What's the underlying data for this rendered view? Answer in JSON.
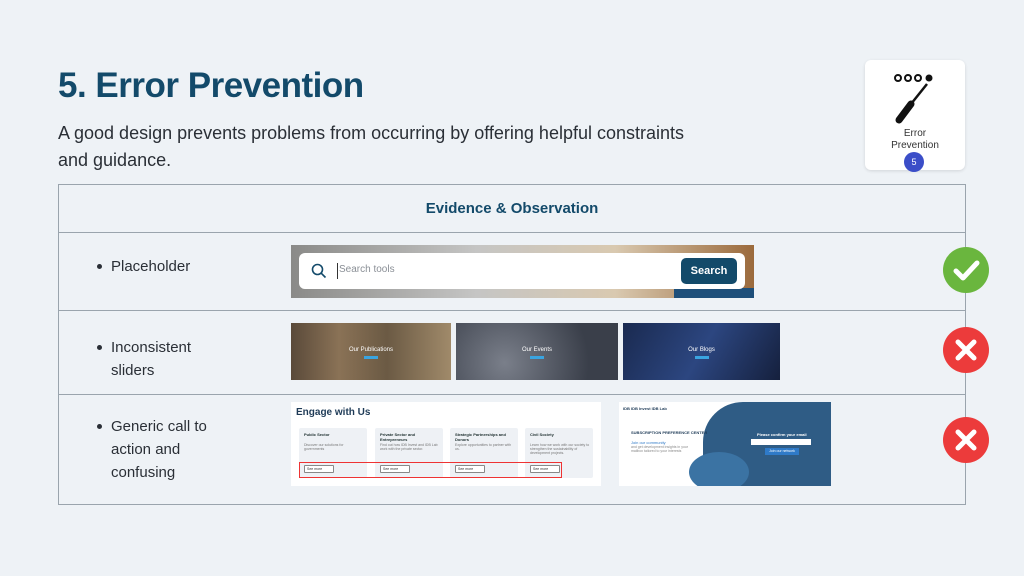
{
  "slide": {
    "title": "5. Error Prevention",
    "subtitle": "A good design prevents problems from occurring by offering helpful constraints and guidance."
  },
  "badge": {
    "label": "Error Prevention",
    "label_line1": "Error",
    "label_line2": "Prevention",
    "number": "5",
    "icon": "screwdriver-icon"
  },
  "table": {
    "header": "Evidence & Observation",
    "rows": [
      {
        "label_lines": [
          "Placeholder"
        ],
        "status": "pass",
        "status_icon": "check-icon"
      },
      {
        "label_lines": [
          "Inconsistent",
          "sliders"
        ],
        "status": "fail",
        "status_icon": "cross-icon"
      },
      {
        "label_lines": [
          "Generic call to",
          "action and",
          "confusing"
        ],
        "status": "fail",
        "status_icon": "cross-icon"
      }
    ]
  },
  "search_shot": {
    "placeholder": "Search tools",
    "button": "Search"
  },
  "sliders": [
    {
      "caption": "Our Publications",
      "bg": "#6b5a44"
    },
    {
      "caption": "Our Events",
      "bg": "#4a4f5a"
    },
    {
      "caption": "Our Blogs",
      "bg": "#1c2e55"
    }
  ],
  "engage_shot": {
    "heading": "Engage with Us",
    "cards": [
      {
        "title": "Public Sector",
        "desc": "Discover our solutions for governments",
        "cta": "See more"
      },
      {
        "title": "Private Sector and Entrepreneurs",
        "desc": "Find out how IDB Invest and IDB Lab work with the private sector.",
        "cta": "See more"
      },
      {
        "title": "Strategic Partnerships and Donors",
        "desc": "Explore opportunities to partner with us.",
        "cta": "See more"
      },
      {
        "title": "Civil Society",
        "desc": "Learn how we work with our society to strengthen the sustainability of development projects.",
        "cta": "See more"
      }
    ]
  },
  "subs_shot": {
    "logos": "IDB  IDB Invest  IDB Lab",
    "heading": "SUBSCRIPTION PREFERENCE CENTER",
    "join_link": "Join our community",
    "join_text": "and get development insights in your mailbox tailored to your interests",
    "prompt": "Please confirm your email",
    "join_button": "Join our network"
  },
  "colors": {
    "title": "#134a6a",
    "pass": "#6ab63e",
    "fail": "#ec3b3b",
    "search_button": "#134a6a"
  }
}
